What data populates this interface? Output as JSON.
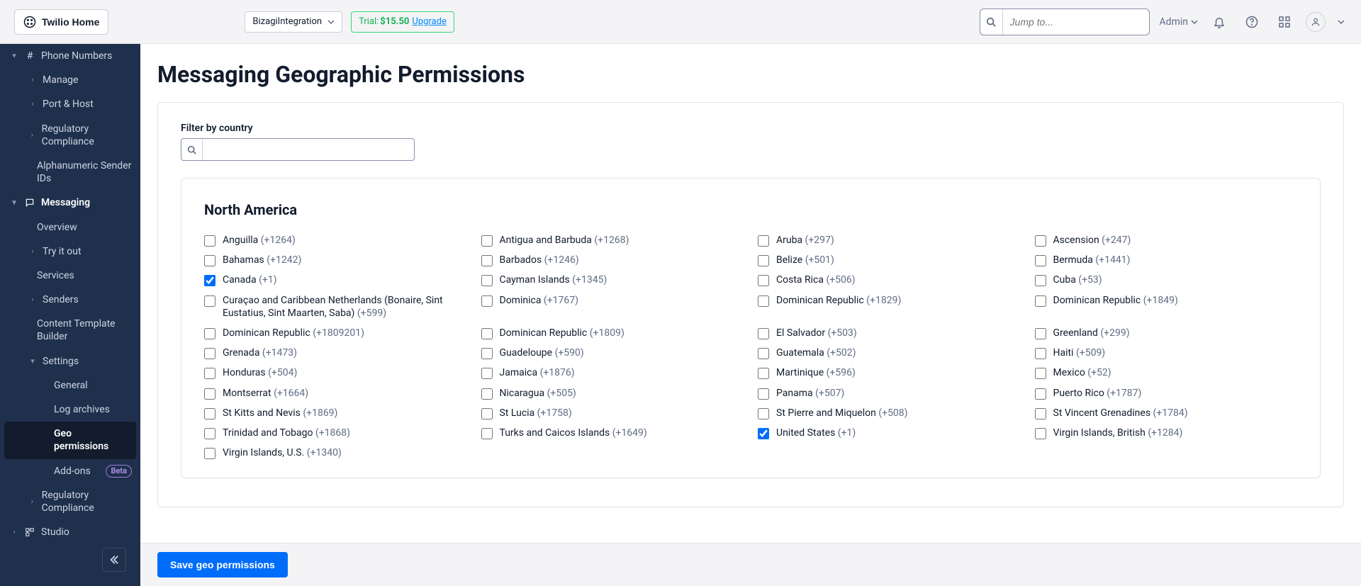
{
  "header": {
    "home_label": "Twilio Home",
    "project_name": "BizagiIntegration",
    "trial_prefix": "Trial: ",
    "trial_amount": "$15.50",
    "upgrade_label": "Upgrade",
    "jump_placeholder": "Jump to...",
    "admin_label": "Admin"
  },
  "sidebar": {
    "phone_numbers": "Phone Numbers",
    "manage": "Manage",
    "port_host": "Port & Host",
    "reg_compliance": "Regulatory Compliance",
    "alpha_sender": "Alphanumeric Sender IDs",
    "messaging": "Messaging",
    "overview": "Overview",
    "try_it": "Try it out",
    "services": "Services",
    "senders": "Senders",
    "content_tpl": "Content Template Builder",
    "settings": "Settings",
    "general": "General",
    "log_archives": "Log archives",
    "geo_permissions": "Geo permissions",
    "addons": "Add-ons",
    "beta": "Beta",
    "reg_compliance2": "Regulatory Compliance",
    "studio": "Studio"
  },
  "page": {
    "title": "Messaging Geographic Permissions",
    "filter_label": "Filter by country",
    "region_title": "North America",
    "save_label": "Save geo permissions"
  },
  "countries": [
    {
      "name": "Anguilla",
      "code": "(+1264)",
      "checked": false
    },
    {
      "name": "Antigua and Barbuda",
      "code": "(+1268)",
      "checked": false
    },
    {
      "name": "Aruba",
      "code": "(+297)",
      "checked": false
    },
    {
      "name": "Ascension",
      "code": "(+247)",
      "checked": false
    },
    {
      "name": "Bahamas",
      "code": "(+1242)",
      "checked": false
    },
    {
      "name": "Barbados",
      "code": "(+1246)",
      "checked": false
    },
    {
      "name": "Belize",
      "code": "(+501)",
      "checked": false
    },
    {
      "name": "Bermuda",
      "code": "(+1441)",
      "checked": false
    },
    {
      "name": "Canada",
      "code": "(+1)",
      "checked": true
    },
    {
      "name": "Cayman Islands",
      "code": "(+1345)",
      "checked": false
    },
    {
      "name": "Costa Rica",
      "code": "(+506)",
      "checked": false
    },
    {
      "name": "Cuba",
      "code": "(+53)",
      "checked": false
    },
    {
      "name": "Curaçao and Caribbean Netherlands (Bonaire, Sint Eustatius, Sint Maarten, Saba)",
      "code": "(+599)",
      "checked": false
    },
    {
      "name": "Dominica",
      "code": "(+1767)",
      "checked": false
    },
    {
      "name": "Dominican Republic",
      "code": "(+1829)",
      "checked": false
    },
    {
      "name": "Dominican Republic",
      "code": "(+1849)",
      "checked": false
    },
    {
      "name": "Dominican Republic",
      "code": "(+1809201)",
      "checked": false
    },
    {
      "name": "Dominican Republic",
      "code": "(+1809)",
      "checked": false
    },
    {
      "name": "El Salvador",
      "code": "(+503)",
      "checked": false
    },
    {
      "name": "Greenland",
      "code": "(+299)",
      "checked": false
    },
    {
      "name": "Grenada",
      "code": "(+1473)",
      "checked": false
    },
    {
      "name": "Guadeloupe",
      "code": "(+590)",
      "checked": false
    },
    {
      "name": "Guatemala",
      "code": "(+502)",
      "checked": false
    },
    {
      "name": "Haiti",
      "code": "(+509)",
      "checked": false
    },
    {
      "name": "Honduras",
      "code": "(+504)",
      "checked": false
    },
    {
      "name": "Jamaica",
      "code": "(+1876)",
      "checked": false
    },
    {
      "name": "Martinique",
      "code": "(+596)",
      "checked": false
    },
    {
      "name": "Mexico",
      "code": "(+52)",
      "checked": false
    },
    {
      "name": "Montserrat",
      "code": "(+1664)",
      "checked": false
    },
    {
      "name": "Nicaragua",
      "code": "(+505)",
      "checked": false
    },
    {
      "name": "Panama",
      "code": "(+507)",
      "checked": false
    },
    {
      "name": "Puerto Rico",
      "code": "(+1787)",
      "checked": false
    },
    {
      "name": "St Kitts and Nevis",
      "code": "(+1869)",
      "checked": false
    },
    {
      "name": "St Lucia",
      "code": "(+1758)",
      "checked": false
    },
    {
      "name": "St Pierre and Miquelon",
      "code": "(+508)",
      "checked": false
    },
    {
      "name": "St Vincent Grenadines",
      "code": "(+1784)",
      "checked": false
    },
    {
      "name": "Trinidad and Tobago",
      "code": "(+1868)",
      "checked": false
    },
    {
      "name": "Turks and Caicos Islands",
      "code": "(+1649)",
      "checked": false
    },
    {
      "name": "United States",
      "code": "(+1)",
      "checked": true
    },
    {
      "name": "Virgin Islands, British",
      "code": "(+1284)",
      "checked": false
    },
    {
      "name": "Virgin Islands, U.S.",
      "code": "(+1340)",
      "checked": false
    }
  ]
}
